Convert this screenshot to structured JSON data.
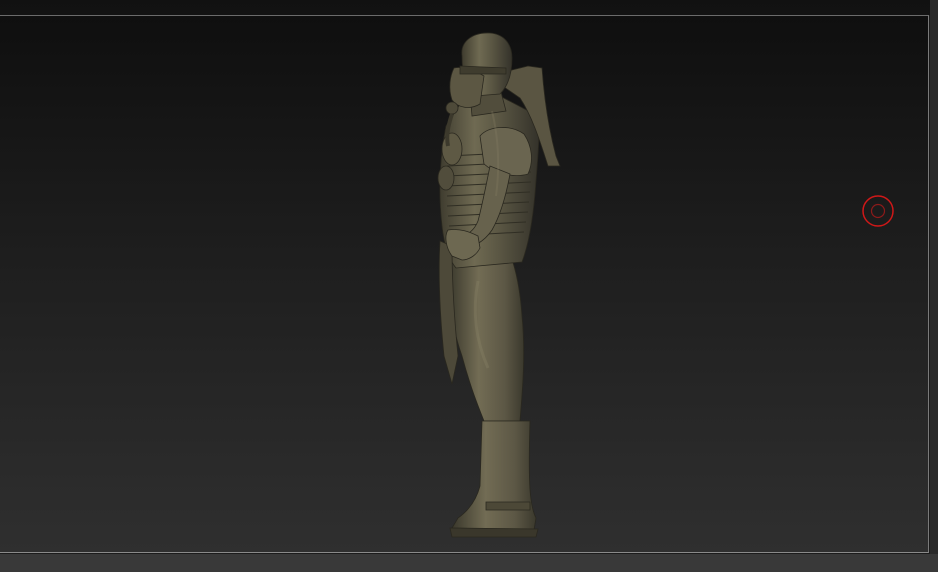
{
  "viewport": {
    "description_name": "3d-viewport",
    "background_top": "#0f0f0f",
    "background_bottom": "#2f2f2f",
    "frame_color": "#8a8a8a"
  },
  "model": {
    "material_color": "#5e5a45",
    "highlight_color": "#8a8466",
    "shadow_color": "#2e2c22"
  },
  "gizmo": {
    "icon": "rotation-target-icon",
    "color": "#d01818"
  }
}
